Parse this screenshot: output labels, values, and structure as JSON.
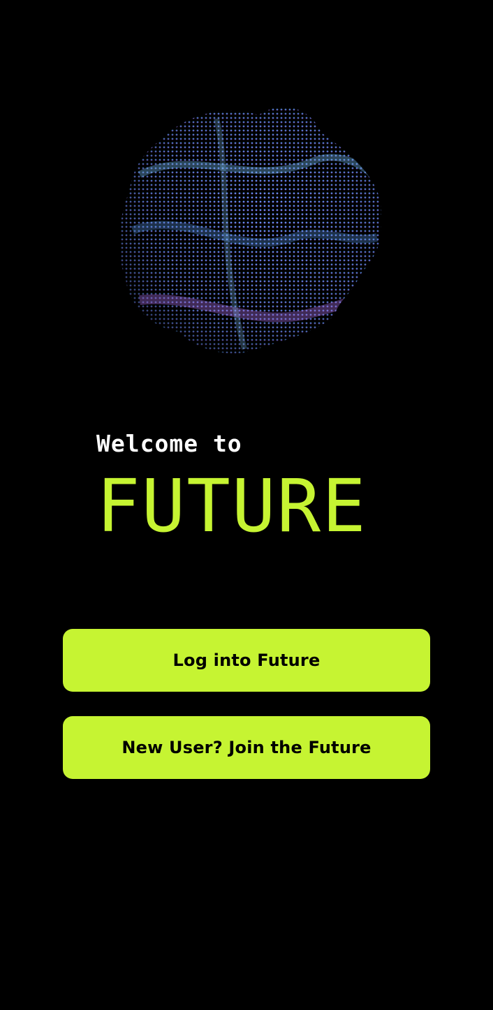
{
  "welcome": {
    "greeting": "Welcome to",
    "brand": "FUTURE"
  },
  "hero": {
    "icon": "particle-sphere-illustration",
    "gradient": [
      "#5aa8f5",
      "#4a7ff0",
      "#a768f0"
    ]
  },
  "actions": {
    "login_label": "Log into Future",
    "signup_label": "New User? Join the Future"
  },
  "colors": {
    "background": "#000000",
    "accent": "#c6f432",
    "text_primary": "#ffffff",
    "button_text": "#000000"
  }
}
